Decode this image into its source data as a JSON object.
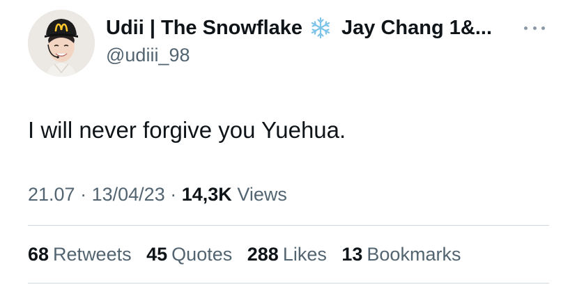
{
  "author": {
    "display_name_part1": "Udii | The Snowflake",
    "display_name_part2": "Jay Chang 1&...",
    "emoji_icon": "snowflake-icon",
    "handle": "@udiii_98",
    "avatar_icon": "profile-avatar"
  },
  "menu": {
    "icon": "more-options-icon"
  },
  "tweet": {
    "text": "I will never forgive you Yuehua."
  },
  "meta": {
    "time": "21.07",
    "date": "13/04/23",
    "separator": "·",
    "views_count": "14,3K",
    "views_label": "Views"
  },
  "stats": [
    {
      "count": "68",
      "label": "Retweets"
    },
    {
      "count": "45",
      "label": "Quotes"
    },
    {
      "count": "288",
      "label": "Likes"
    },
    {
      "count": "13",
      "label": "Bookmarks"
    }
  ],
  "colors": {
    "text_primary": "#0f1419",
    "text_secondary": "#536471",
    "divider": "#cfd9de"
  }
}
